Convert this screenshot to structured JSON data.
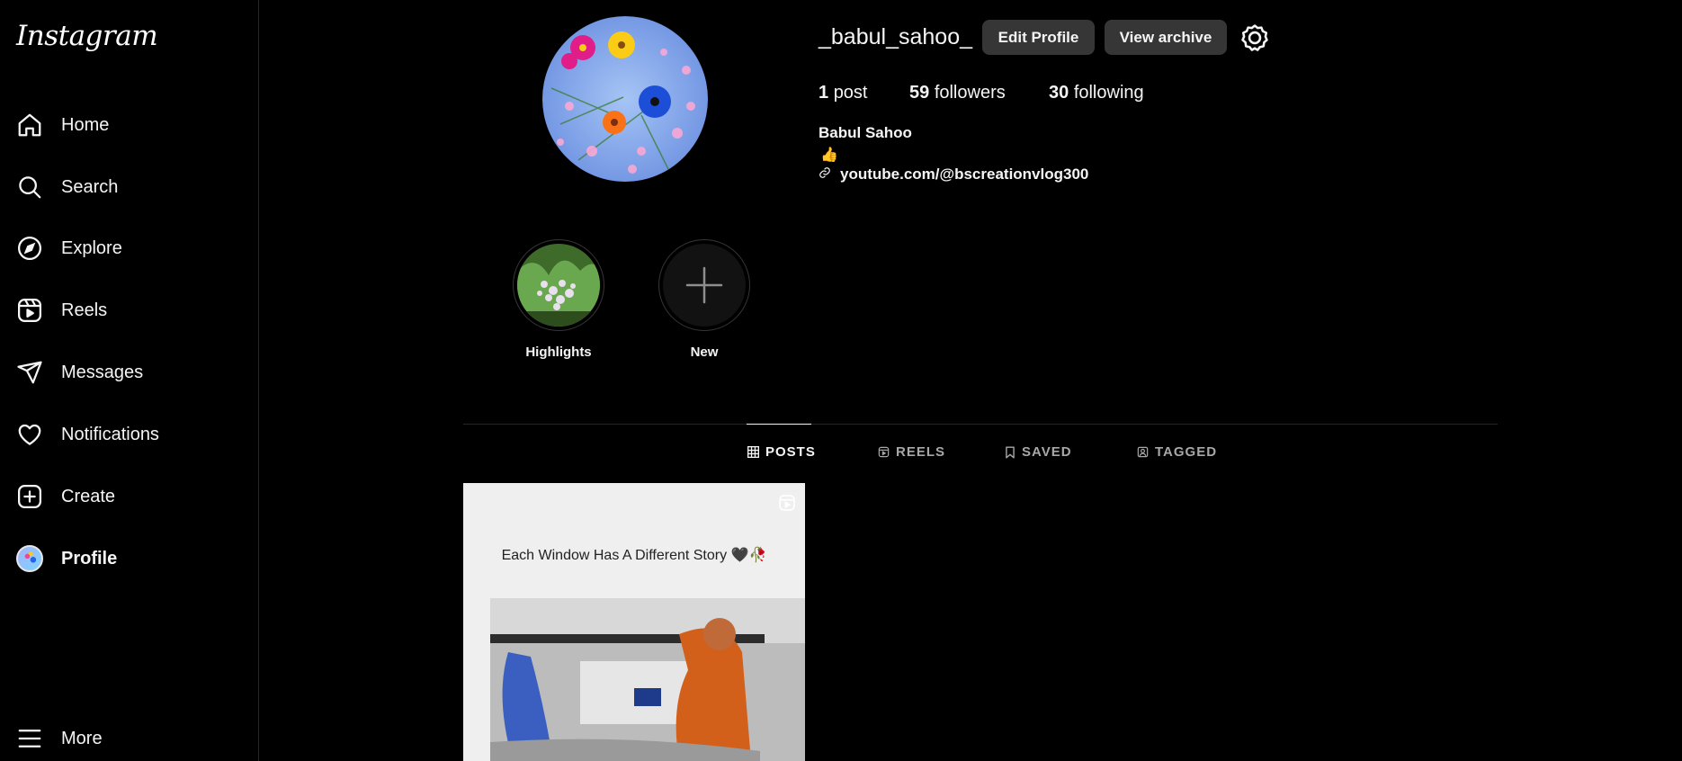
{
  "sidebar": {
    "logo": "Instagram",
    "items": [
      {
        "label": "Home",
        "icon": "home-icon"
      },
      {
        "label": "Search",
        "icon": "search-icon"
      },
      {
        "label": "Explore",
        "icon": "compass-icon"
      },
      {
        "label": "Reels",
        "icon": "reels-icon"
      },
      {
        "label": "Messages",
        "icon": "paper-plane-icon"
      },
      {
        "label": "Notifications",
        "icon": "heart-icon"
      },
      {
        "label": "Create",
        "icon": "plus-square-icon"
      },
      {
        "label": "Profile",
        "icon": "avatar"
      },
      {
        "label": "More",
        "icon": "menu-icon"
      }
    ]
  },
  "profile": {
    "username": "_babul_sahoo_",
    "edit_label": "Edit Profile",
    "archive_label": "View archive",
    "settings_icon": "gear-icon",
    "stats": {
      "posts_count": "1",
      "posts_label": "post",
      "followers_count": "59",
      "followers_label": "followers",
      "following_count": "30",
      "following_label": "following"
    },
    "full_name": "Babul Sahoo",
    "bio_emoji": "👍",
    "link": "youtube.com/@bscreationvlog300"
  },
  "highlights": [
    {
      "label": "Highlights"
    },
    {
      "label": "New"
    }
  ],
  "tabs": [
    {
      "label": "POSTS",
      "icon": "grid-icon",
      "active": true
    },
    {
      "label": "REELS",
      "icon": "reels-icon",
      "active": false
    },
    {
      "label": "SAVED",
      "icon": "bookmark-icon",
      "active": false
    },
    {
      "label": "TAGGED",
      "icon": "tag-user-icon",
      "active": false
    }
  ],
  "posts": [
    {
      "caption": "Each Window Has A Different Story 🖤🥀",
      "type_icon": "reel-badge-icon"
    }
  ],
  "colors": {
    "background": "#000000",
    "button": "#363636",
    "muted": "#a8a8a8"
  }
}
